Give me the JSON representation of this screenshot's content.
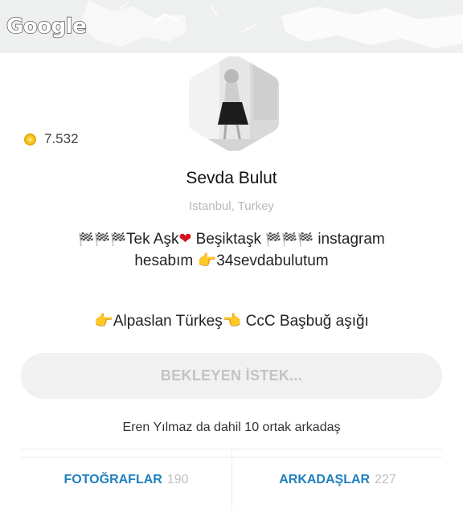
{
  "banner": {
    "logo_text": "Google"
  },
  "profile": {
    "coins": "7.532",
    "name": "Sevda Bulut",
    "location": "Istanbul, Turkey",
    "bio_line1_text1": "Tek Aşk",
    "bio_line1_text2": " Beşiktaşk ",
    "bio_line1_text3": " instagram",
    "bio_line2_text1": "hesabım ",
    "bio_line2_text2": "34sevdabulutum",
    "bio2_text1": "Alpaslan Türkeş",
    "bio2_text2": " CcC  Başbuğ  aşığı",
    "flags": "🏁🏁🏁",
    "heart": "❤",
    "hand_right": "👉",
    "hand_left": "👈"
  },
  "actions": {
    "pending_label": "BEKLEYEN İSTEK..."
  },
  "mutual_friends": "Eren Yılmaz da dahil 10 ortak arkadaş",
  "tabs": [
    {
      "label": "FOTOĞRAFLAR",
      "count": "190"
    },
    {
      "label": "ARKADAŞLAR",
      "count": "227"
    }
  ],
  "colors": {
    "accent": "#1f7fc0",
    "coin": "#f6c623",
    "muted": "#c3c3c3"
  }
}
